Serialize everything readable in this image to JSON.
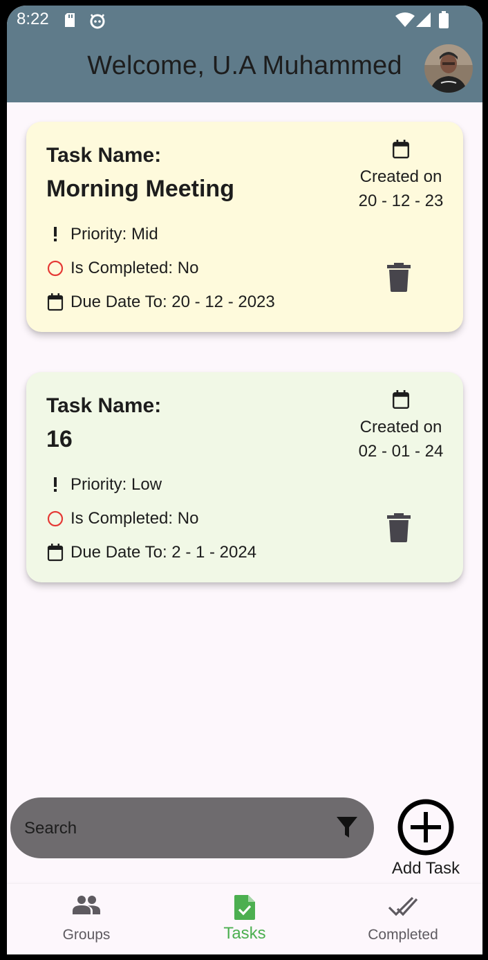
{
  "status_bar": {
    "time": "8:22"
  },
  "header": {
    "welcome": "Welcome, U.A Muhammed"
  },
  "tasks": [
    {
      "label": "Task Name:",
      "name": "Morning Meeting",
      "priority": "Priority: Mid",
      "completed": "Is Completed: No",
      "due": "Due Date To: 20 - 12 - 2023",
      "created_label": "Created on",
      "created_date": "20 - 12 - 23",
      "color": "#fefadc"
    },
    {
      "label": "Task Name:",
      "name": "16",
      "priority": "Priority: Low",
      "completed": "Is Completed: No",
      "due": "Due Date To: 2 - 1 - 2024",
      "created_label": "Created on",
      "created_date": "02 - 01 - 24",
      "color": "#f1f8e6"
    }
  ],
  "search": {
    "placeholder": "Search"
  },
  "add_task": {
    "label": "Add Task"
  },
  "bottom_nav": {
    "items": [
      {
        "label": "Groups",
        "icon": "groups-icon",
        "active": false
      },
      {
        "label": "Tasks",
        "icon": "task-check-icon",
        "active": true
      },
      {
        "label": "Completed",
        "icon": "done-all-icon",
        "active": false
      }
    ]
  },
  "colors": {
    "appbar": "#5f7b8a",
    "accent": "#4caf50",
    "incomplete": "#e53935",
    "search_bg": "#6e6b6e"
  }
}
